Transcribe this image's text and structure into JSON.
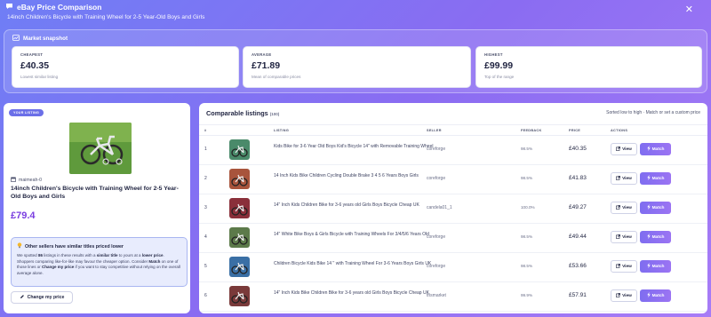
{
  "header": {
    "title": "eBay Price Comparison",
    "subtitle": "14inch Children's Bicycle with Training Wheel for 2-5 Year-Old Boys and Girls",
    "close_icon": "close-icon"
  },
  "snapshot": {
    "title": "Market snapshot",
    "cards": [
      {
        "label": "CHEAPEST",
        "value": "£40.35",
        "note": "Lowest similar listing"
      },
      {
        "label": "AVERAGE",
        "value": "£71.89",
        "note": "Mean of comparable prices"
      },
      {
        "label": "HIGHEST",
        "value": "£99.99",
        "note": "Top of the range"
      }
    ]
  },
  "your_listing": {
    "badge": "YOUR LISTING",
    "seller": "maimeah-0",
    "title": "14inch Children's Bicycle with Training Wheel for 2-5 Year-Old Boys and Girls",
    "price": "£79.4",
    "alert": {
      "title": "Other sellers have similar titles priced lower",
      "t1": "We spotted ",
      "count": "86",
      "t2": " listings in these results with a ",
      "b1": "similar title",
      "t3": " to yours at a ",
      "b2": "lower price",
      "t4": ". Shoppers comparing like-for-like may favour the cheaper option. Consider ",
      "b3": "Match",
      "t5": " on one of those lines or ",
      "b4": "Change my price",
      "t6": " if you want to stay competitive without relying on the overall average alone."
    },
    "change_button": "Change my price"
  },
  "comparables": {
    "title": "Comparable listings",
    "count": "(100)",
    "note": "Sorted low to high · Match or set a custom price",
    "headers": [
      "#",
      "LISTING",
      "SELLER",
      "FEEDBACK",
      "PRICE",
      "ACTIONS"
    ],
    "view_label": "View",
    "match_label": "Match",
    "rows": [
      {
        "num": "1",
        "title": "Kids Bike for 3-6 Year Old Boys Kid's Bicycle 14\" with Removable Training Wheel",
        "seller": "coreforge",
        "feedback": "98.5%",
        "price": "£40.35",
        "thumb_color": "#4a8a6a"
      },
      {
        "num": "2",
        "title": "14 Inch Kids Bike Children Cycling Double Brake 3 4 5 6 Years Boys Girls",
        "seller": "coreforge",
        "feedback": "98.5%",
        "price": "£41.83",
        "thumb_color": "#a8543c"
      },
      {
        "num": "3",
        "title": "14\" Inch Kids Children Bike for 3-6 years old Girls Boys Bicycle Cheap UK",
        "seller": "candela01_1",
        "feedback": "100.0%",
        "price": "£49.27",
        "thumb_color": "#8a2f3a"
      },
      {
        "num": "4",
        "title": "14\" White Bike Boys & Girls Bicycle with Training Wheels For 3/4/5/6 Years Old",
        "seller": "coreforge",
        "feedback": "98.5%",
        "price": "£49.44",
        "thumb_color": "#5c7a4a"
      },
      {
        "num": "5",
        "title": "Children Bicycle Kids Bike 14 '' with Training Wheel For 3-6 Years Boys Girls UK",
        "seller": "coreforge",
        "feedback": "98.5%",
        "price": "£53.66",
        "thumb_color": "#3a6fa5"
      },
      {
        "num": "6",
        "title": "14\" Inch Kids Bike Children Bike for 3-6 years old Girls Boys Bicycle Cheap UK",
        "seller": "trismarket",
        "feedback": "99.9%",
        "price": "£57.91",
        "thumb_color": "#7a3a3a"
      }
    ]
  }
}
